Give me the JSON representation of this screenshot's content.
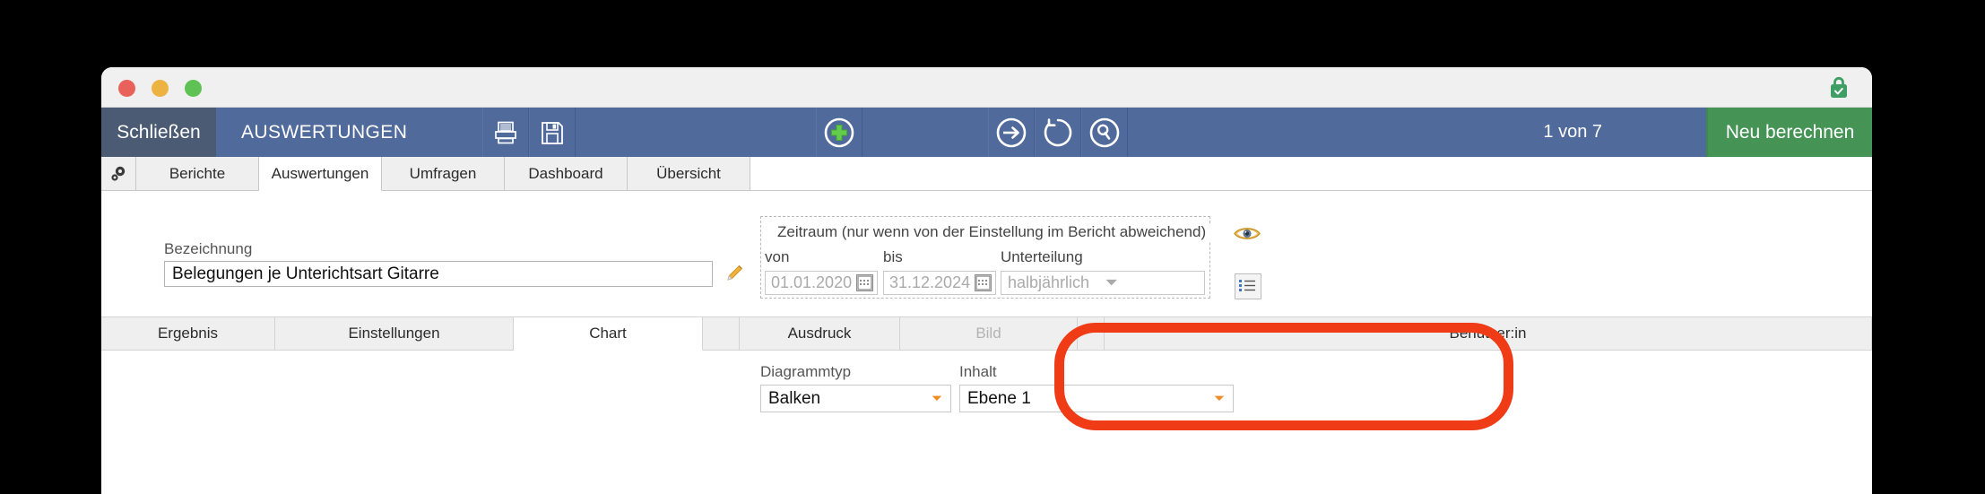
{
  "window": {
    "traffic_lights": [
      "close",
      "minimize",
      "maximize"
    ],
    "lock_status": "secure-lock-icon"
  },
  "toolbar": {
    "close_label": "Schließen",
    "app_title": "AUSWERTUNGEN",
    "icons": [
      "printer-icon",
      "save-icon",
      "add-icon",
      "arrow-right-icon",
      "refresh-icon",
      "search-icon"
    ],
    "record_counter": "1 von 7",
    "recalculate_label": "Neu berechnen",
    "accent_blue": "#4f6a9b",
    "close_blue": "#4b5b74",
    "green": "#459455"
  },
  "main_tabs": {
    "gear_icon": "gear-icon",
    "items": [
      {
        "label": "Berichte",
        "active": false
      },
      {
        "label": "Auswertungen",
        "active": true
      },
      {
        "label": "Umfragen",
        "active": false
      },
      {
        "label": "Dashboard",
        "active": false
      },
      {
        "label": "Übersicht",
        "active": false
      }
    ]
  },
  "form": {
    "bezeichnung_label": "Bezeichnung",
    "bezeichnung_value": "Belegungen je Unterichtsart Gitarre",
    "pencil_icon": "pencil-icon",
    "eye_icon": "eye-icon",
    "list_icon": "list-icon"
  },
  "zeitraum": {
    "group_title": "Zeitraum (nur wenn von der Einstellung im Bericht abweichend)",
    "von_label": "von",
    "bis_label": "bis",
    "unterteilung_label": "Unterteilung",
    "von_value": "01.01.2020",
    "bis_value": "31.12.2024",
    "unterteilung_value": "halbjährlich",
    "calendar_icon": "calendar-icon",
    "chevron_color": "#ef8b22"
  },
  "sub_tabs": {
    "items": [
      {
        "label": "Ergebnis",
        "active": false,
        "disabled": false
      },
      {
        "label": "Einstellungen",
        "active": false,
        "disabled": false
      },
      {
        "label": "Chart",
        "active": true,
        "disabled": false
      },
      {
        "label": "Ausdruck",
        "active": false,
        "disabled": false
      },
      {
        "label": "Bild",
        "active": false,
        "disabled": true
      },
      {
        "label": "Benutzer:in",
        "active": false,
        "disabled": false
      }
    ]
  },
  "chart_settings": {
    "diagrammtyp_label": "Diagrammtyp",
    "diagrammtyp_value": "Balken",
    "inhalt_label": "Inhalt",
    "inhalt_value": "Ebene 1"
  },
  "annotation": {
    "shape": "rounded-rectangle-highlight",
    "color": "#ef3b16"
  }
}
